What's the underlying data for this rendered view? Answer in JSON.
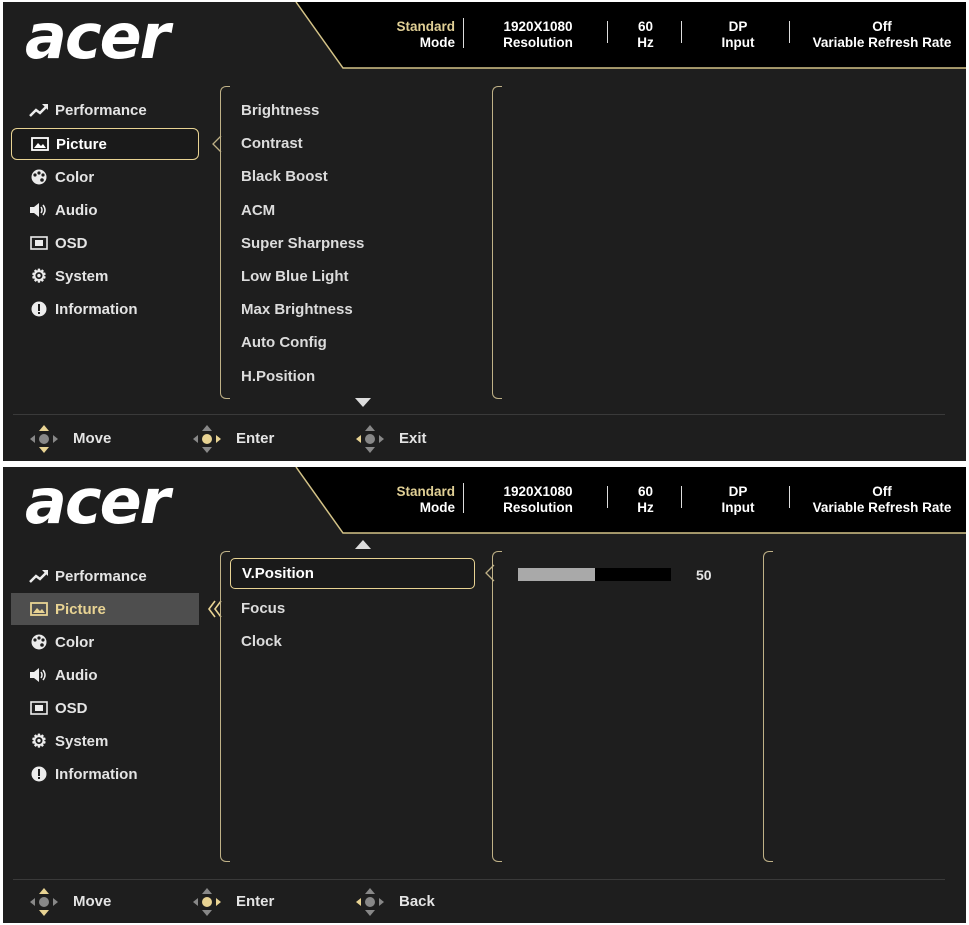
{
  "header": {
    "logo": "acer",
    "mode_value": "Standard",
    "mode_label": "Mode",
    "resolution_value": "1920X1080",
    "resolution_label": "Resolution",
    "refresh_value": "60",
    "refresh_label": "Hz",
    "input_value": "DP",
    "input_label": "Input",
    "vrr_value": "Off",
    "vrr_label": "Variable Refresh Rate"
  },
  "main_menu": [
    {
      "label": "Performance",
      "icon": "trend-arrow-icon"
    },
    {
      "label": "Picture",
      "icon": "picture-icon"
    },
    {
      "label": "Color",
      "icon": "palette-icon"
    },
    {
      "label": "Audio",
      "icon": "speaker-icon"
    },
    {
      "label": "OSD",
      "icon": "osd-icon"
    },
    {
      "label": "System",
      "icon": "gear-icon"
    },
    {
      "label": "Information",
      "icon": "info-icon"
    }
  ],
  "screen1": {
    "submenu": [
      "Brightness",
      "Contrast",
      "Black Boost",
      "ACM",
      "Super Sharpness",
      "Low Blue Light",
      "Max Brightness",
      "Auto Config",
      "H.Position"
    ],
    "footer": {
      "move": "Move",
      "enter": "Enter",
      "exit": "Exit"
    }
  },
  "screen2": {
    "submenu": [
      "V.Position",
      "Focus",
      "Clock"
    ],
    "v_position_value": "50",
    "v_position_level": 0.5,
    "footer": {
      "move": "Move",
      "enter": "Enter",
      "back": "Back"
    }
  },
  "colors": {
    "accent": "#e8d393",
    "panel": "#1e1e1e",
    "header": "#000000"
  }
}
